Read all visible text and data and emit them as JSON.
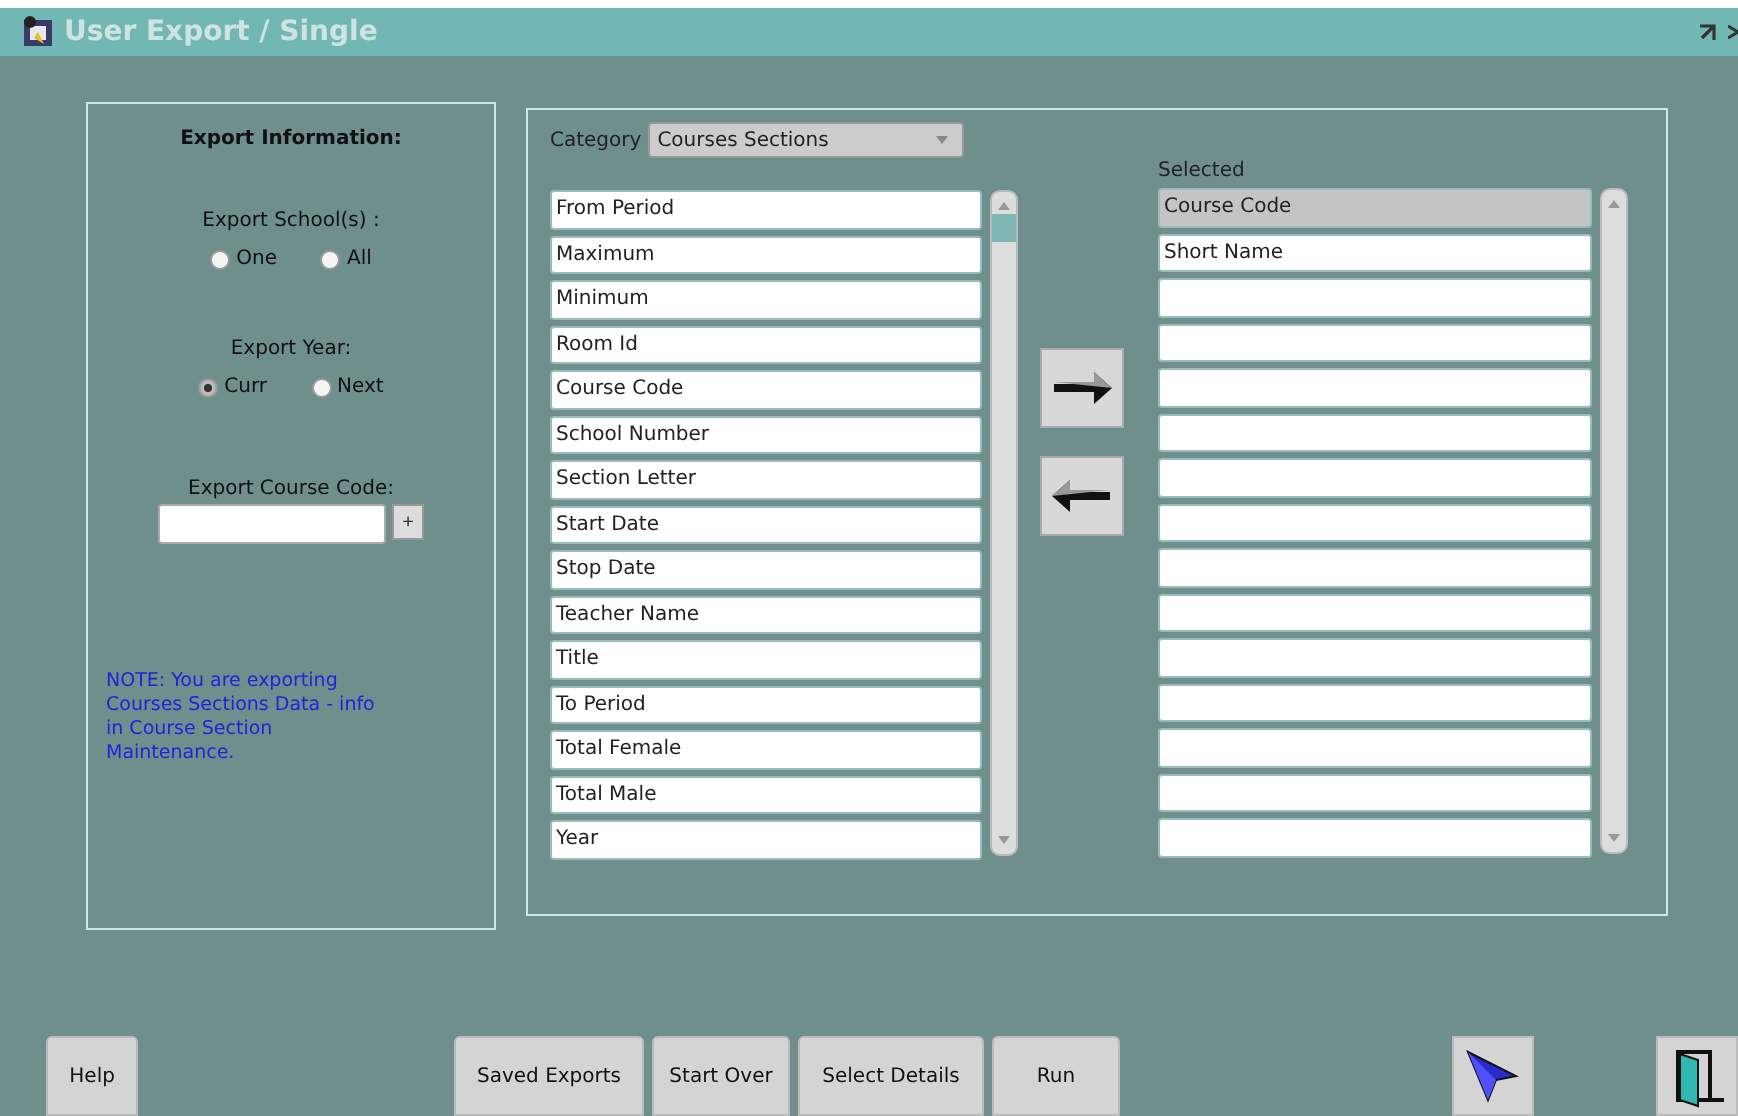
{
  "window": {
    "title": "User Export / Single"
  },
  "export_info": {
    "heading": "Export Information:",
    "schools": {
      "label": "Export School(s) :",
      "options": [
        {
          "label": "One",
          "selected": false
        },
        {
          "label": "All",
          "selected": false
        }
      ]
    },
    "year": {
      "label": "Export Year:",
      "options": [
        {
          "label": "Curr",
          "selected": true
        },
        {
          "label": "Next",
          "selected": false
        }
      ]
    },
    "course_code": {
      "label": "Export Course Code:",
      "button": "+"
    },
    "note": "NOTE: You are exporting Courses Sections Data - info in Course Section Maintenance."
  },
  "category": {
    "label": "Category",
    "value": "Courses Sections"
  },
  "available": [
    "From Period",
    "Maximum",
    "Minimum",
    "Room Id",
    "Course Code",
    "School Number",
    "Section Letter",
    "Start Date",
    "Stop Date",
    "Teacher Name",
    "Title",
    "To Period",
    "Total Female",
    "Total Male",
    "Year"
  ],
  "selected_list": {
    "label": "Selected",
    "rows": [
      {
        "text": "Course Code",
        "selected": true
      },
      {
        "text": "Short Name",
        "selected": false
      }
    ]
  },
  "buttons": [
    {
      "label": "Help",
      "kind": "left"
    },
    {
      "label": "Saved Exports",
      "kind": "center"
    },
    {
      "label": "Start Over",
      "kind": "center"
    },
    {
      "label": "Select Details",
      "kind": "center"
    },
    {
      "label": "Run",
      "kind": "center"
    }
  ]
}
